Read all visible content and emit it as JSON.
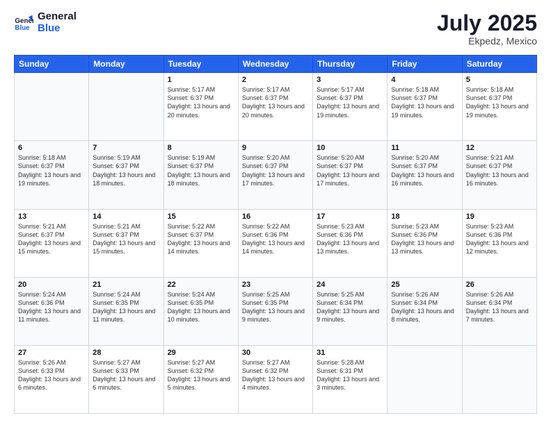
{
  "header": {
    "logo_text_general": "General",
    "logo_text_blue": "Blue",
    "month_year": "July 2025",
    "location": "Ekpedz, Mexico"
  },
  "days_of_week": [
    "Sunday",
    "Monday",
    "Tuesday",
    "Wednesday",
    "Thursday",
    "Friday",
    "Saturday"
  ],
  "weeks": [
    [
      {
        "day": "",
        "info": ""
      },
      {
        "day": "",
        "info": ""
      },
      {
        "day": "1",
        "info": "Sunrise: 5:17 AM\nSunset: 6:37 PM\nDaylight: 13 hours and 20 minutes."
      },
      {
        "day": "2",
        "info": "Sunrise: 5:17 AM\nSunset: 6:37 PM\nDaylight: 13 hours and 20 minutes."
      },
      {
        "day": "3",
        "info": "Sunrise: 5:17 AM\nSunset: 6:37 PM\nDaylight: 13 hours and 19 minutes."
      },
      {
        "day": "4",
        "info": "Sunrise: 5:18 AM\nSunset: 6:37 PM\nDaylight: 13 hours and 19 minutes."
      },
      {
        "day": "5",
        "info": "Sunrise: 5:18 AM\nSunset: 6:37 PM\nDaylight: 13 hours and 19 minutes."
      }
    ],
    [
      {
        "day": "6",
        "info": "Sunrise: 5:18 AM\nSunset: 6:37 PM\nDaylight: 13 hours and 19 minutes."
      },
      {
        "day": "7",
        "info": "Sunrise: 5:19 AM\nSunset: 6:37 PM\nDaylight: 13 hours and 18 minutes."
      },
      {
        "day": "8",
        "info": "Sunrise: 5:19 AM\nSunset: 6:37 PM\nDaylight: 13 hours and 18 minutes."
      },
      {
        "day": "9",
        "info": "Sunrise: 5:20 AM\nSunset: 6:37 PM\nDaylight: 13 hours and 17 minutes."
      },
      {
        "day": "10",
        "info": "Sunrise: 5:20 AM\nSunset: 6:37 PM\nDaylight: 13 hours and 17 minutes."
      },
      {
        "day": "11",
        "info": "Sunrise: 5:20 AM\nSunset: 6:37 PM\nDaylight: 13 hours and 16 minutes."
      },
      {
        "day": "12",
        "info": "Sunrise: 5:21 AM\nSunset: 6:37 PM\nDaylight: 13 hours and 16 minutes."
      }
    ],
    [
      {
        "day": "13",
        "info": "Sunrise: 5:21 AM\nSunset: 6:37 PM\nDaylight: 13 hours and 15 minutes."
      },
      {
        "day": "14",
        "info": "Sunrise: 5:21 AM\nSunset: 6:37 PM\nDaylight: 13 hours and 15 minutes."
      },
      {
        "day": "15",
        "info": "Sunrise: 5:22 AM\nSunset: 6:37 PM\nDaylight: 13 hours and 14 minutes."
      },
      {
        "day": "16",
        "info": "Sunrise: 5:22 AM\nSunset: 6:36 PM\nDaylight: 13 hours and 14 minutes."
      },
      {
        "day": "17",
        "info": "Sunrise: 5:23 AM\nSunset: 6:36 PM\nDaylight: 13 hours and 13 minutes."
      },
      {
        "day": "18",
        "info": "Sunrise: 5:23 AM\nSunset: 6:36 PM\nDaylight: 13 hours and 13 minutes."
      },
      {
        "day": "19",
        "info": "Sunrise: 5:23 AM\nSunset: 6:36 PM\nDaylight: 13 hours and 12 minutes."
      }
    ],
    [
      {
        "day": "20",
        "info": "Sunrise: 5:24 AM\nSunset: 6:36 PM\nDaylight: 13 hours and 11 minutes."
      },
      {
        "day": "21",
        "info": "Sunrise: 5:24 AM\nSunset: 6:35 PM\nDaylight: 13 hours and 11 minutes."
      },
      {
        "day": "22",
        "info": "Sunrise: 5:24 AM\nSunset: 6:35 PM\nDaylight: 13 hours and 10 minutes."
      },
      {
        "day": "23",
        "info": "Sunrise: 5:25 AM\nSunset: 6:35 PM\nDaylight: 13 hours and 9 minutes."
      },
      {
        "day": "24",
        "info": "Sunrise: 5:25 AM\nSunset: 6:34 PM\nDaylight: 13 hours and 9 minutes."
      },
      {
        "day": "25",
        "info": "Sunrise: 5:26 AM\nSunset: 6:34 PM\nDaylight: 13 hours and 8 minutes."
      },
      {
        "day": "26",
        "info": "Sunrise: 5:26 AM\nSunset: 6:34 PM\nDaylight: 13 hours and 7 minutes."
      }
    ],
    [
      {
        "day": "27",
        "info": "Sunrise: 5:26 AM\nSunset: 6:33 PM\nDaylight: 13 hours and 6 minutes."
      },
      {
        "day": "28",
        "info": "Sunrise: 5:27 AM\nSunset: 6:33 PM\nDaylight: 13 hours and 6 minutes."
      },
      {
        "day": "29",
        "info": "Sunrise: 5:27 AM\nSunset: 6:32 PM\nDaylight: 13 hours and 5 minutes."
      },
      {
        "day": "30",
        "info": "Sunrise: 5:27 AM\nSunset: 6:32 PM\nDaylight: 13 hours and 4 minutes."
      },
      {
        "day": "31",
        "info": "Sunrise: 5:28 AM\nSunset: 6:31 PM\nDaylight: 13 hours and 3 minutes."
      },
      {
        "day": "",
        "info": ""
      },
      {
        "day": "",
        "info": ""
      }
    ]
  ]
}
